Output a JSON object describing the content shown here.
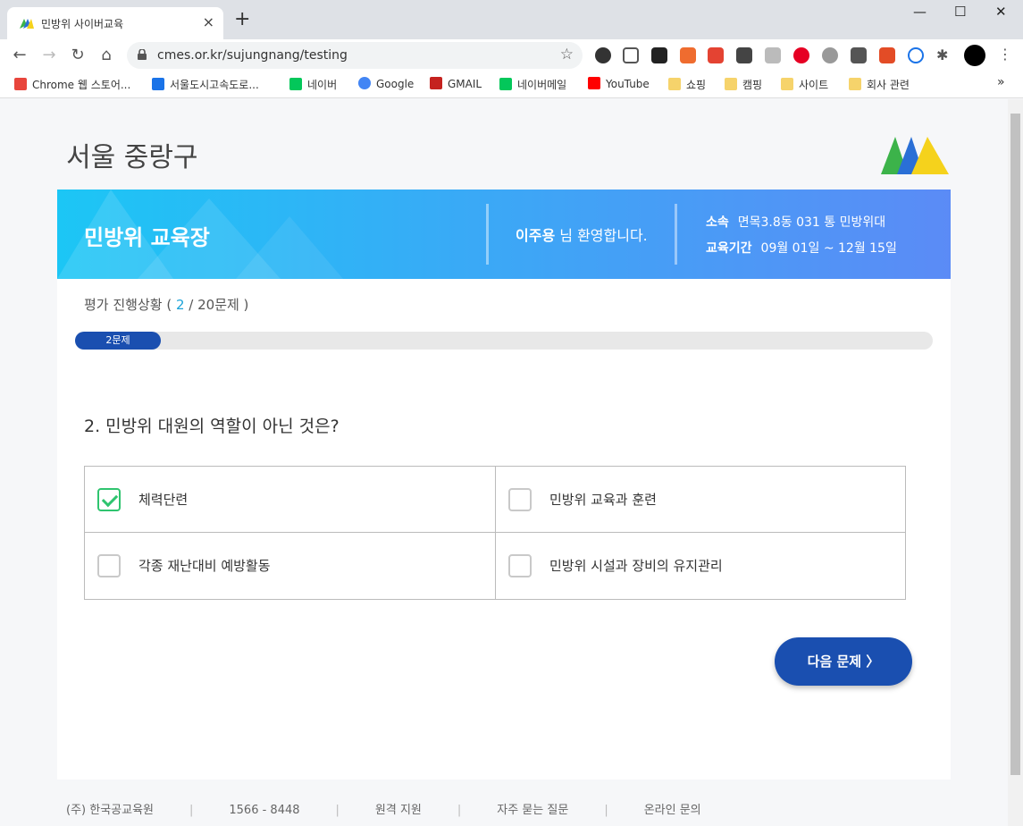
{
  "browser": {
    "tab_title": "민방위 사이버교육",
    "tab_close": "×",
    "new_tab": "+",
    "url": "cmes.or.kr/sujungnang/testing",
    "window_controls": [
      "—",
      "☐",
      "✕"
    ],
    "bookmarks": [
      {
        "label": "Chrome 웹 스토어...",
        "icon": "chrome-store-icon",
        "color": "#e8453c"
      },
      {
        "label": "서울도시고속도로...",
        "icon": "seoul-highway-icon",
        "color": "#1a73e8"
      },
      {
        "label": "네이버",
        "icon": "naver-icon",
        "color": "#03c75a"
      },
      {
        "label": "Google",
        "icon": "google-icon",
        "color": "#4285f4"
      },
      {
        "label": "GMAIL",
        "icon": "gmail-icon",
        "color": "#c5221f"
      },
      {
        "label": "네이버메일",
        "icon": "naver-mail-icon",
        "color": "#03c75a"
      },
      {
        "label": "YouTube",
        "icon": "youtube-icon",
        "color": "#ff0000"
      },
      {
        "label": "쇼핑",
        "icon": "folder-icon",
        "color": "#f6d36b"
      },
      {
        "label": "캠핑",
        "icon": "folder-icon",
        "color": "#f6d36b"
      },
      {
        "label": "사이트",
        "icon": "folder-icon",
        "color": "#f6d36b"
      },
      {
        "label": "회사 관련",
        "icon": "folder-icon",
        "color": "#f6d36b"
      }
    ],
    "bookmarks_overflow": "»"
  },
  "site": {
    "region_title": "서울 중랑구"
  },
  "banner": {
    "name": "민방위 교육장",
    "user_name": "이주용",
    "welcome_suffix": " 님 환영합니다.",
    "affiliation_label": "소속",
    "affiliation_value": "면목3.8동 031 통 민방위대",
    "period_label": "교육기간",
    "period_value": "09월 01일 ~ 12월 15일"
  },
  "progress": {
    "label_prefix": "평가 진행상황 ( ",
    "current": "2",
    "label_suffix": " / 20문제 )",
    "bar_text": "2문제",
    "fraction": 0.1
  },
  "question": {
    "text": "2. 민방위 대원의 역할이 아닌 것은?",
    "options": [
      {
        "label": "체력단련",
        "checked": true
      },
      {
        "label": "민방위 교육과 훈련",
        "checked": false
      },
      {
        "label": "각종 재난대비 예방활동",
        "checked": false
      },
      {
        "label": "민방위 시설과 장비의 유지관리",
        "checked": false
      }
    ]
  },
  "actions": {
    "next_label": "다음 문제 〉"
  },
  "footer": {
    "items": [
      "(주) 한국공교육원",
      "1566 - 8448",
      "원격 지원",
      "자주 묻는 질문",
      "온라인 문의"
    ],
    "separator": "|"
  },
  "colors": {
    "accent": "#1a4fb0",
    "check": "#2fc46f",
    "banner_start": "#1cc6f5",
    "banner_end": "#5b8bf6"
  }
}
